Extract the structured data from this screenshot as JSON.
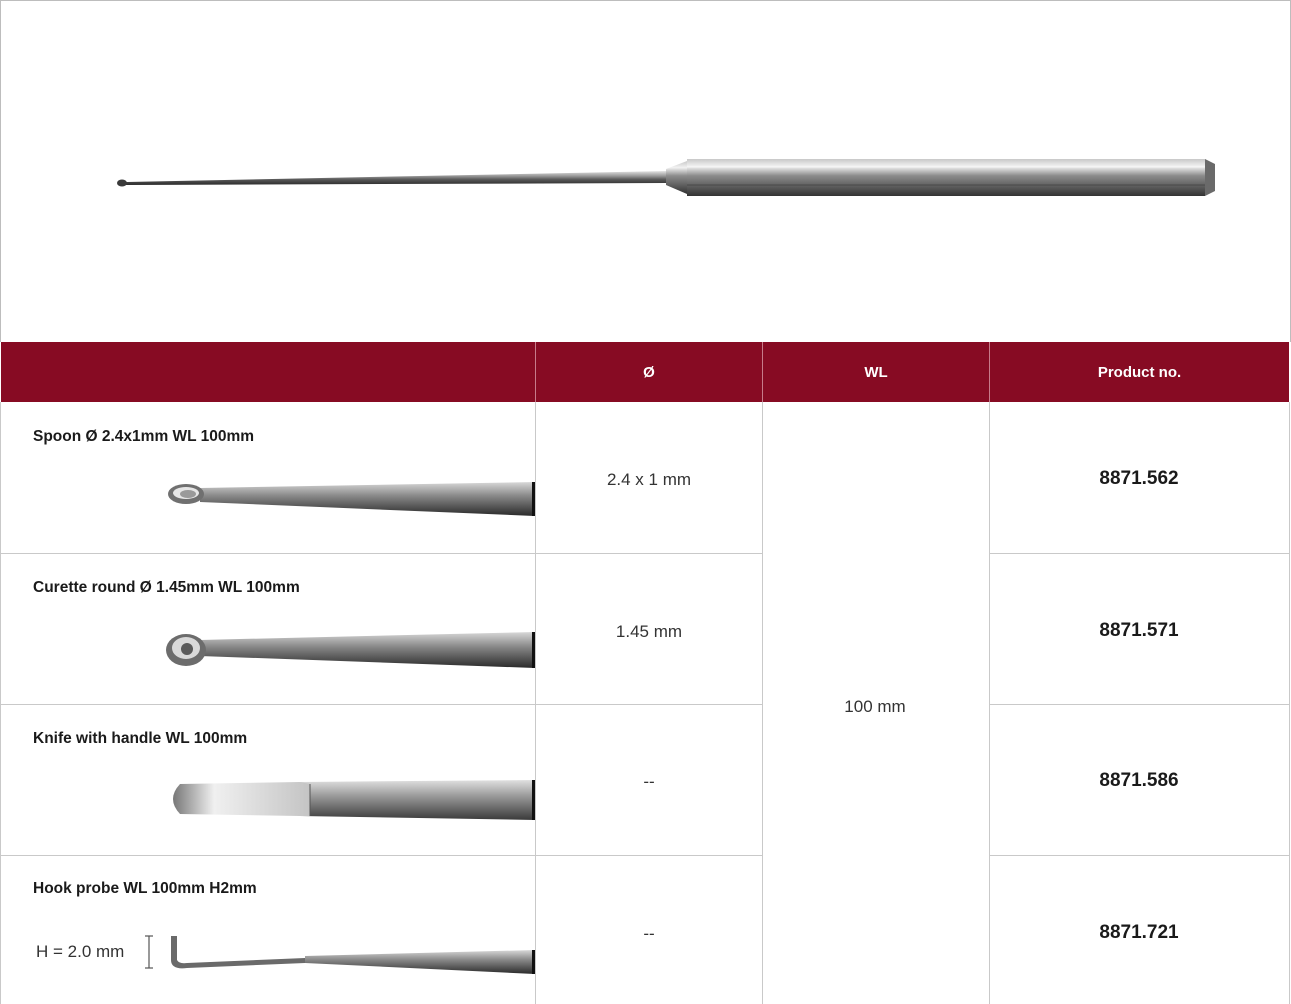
{
  "table": {
    "headers": [
      "",
      "Ø",
      "WL",
      "Product no."
    ],
    "wl_shared": "100 mm",
    "rows": [
      {
        "name": "Spoon Ø 2.4x1mm WL 100mm",
        "diameter": "2.4 x 1 mm",
        "product_no": "8871.562",
        "tip": "spoon"
      },
      {
        "name": "Curette round Ø 1.45mm WL 100mm",
        "diameter": "1.45 mm",
        "product_no": "8871.571",
        "tip": "curette"
      },
      {
        "name": "Knife with handle WL 100mm",
        "diameter": "--",
        "product_no": "8871.586",
        "tip": "knife"
      },
      {
        "name": "Hook probe WL 100mm H2mm",
        "diameter": "--",
        "product_no": "8871.721",
        "tip": "hook",
        "height_label": "H = 2.0 mm"
      }
    ]
  },
  "colors": {
    "header_bg": "#870b23",
    "header_text": "#ffffff",
    "grid": "#c9c9c9"
  }
}
